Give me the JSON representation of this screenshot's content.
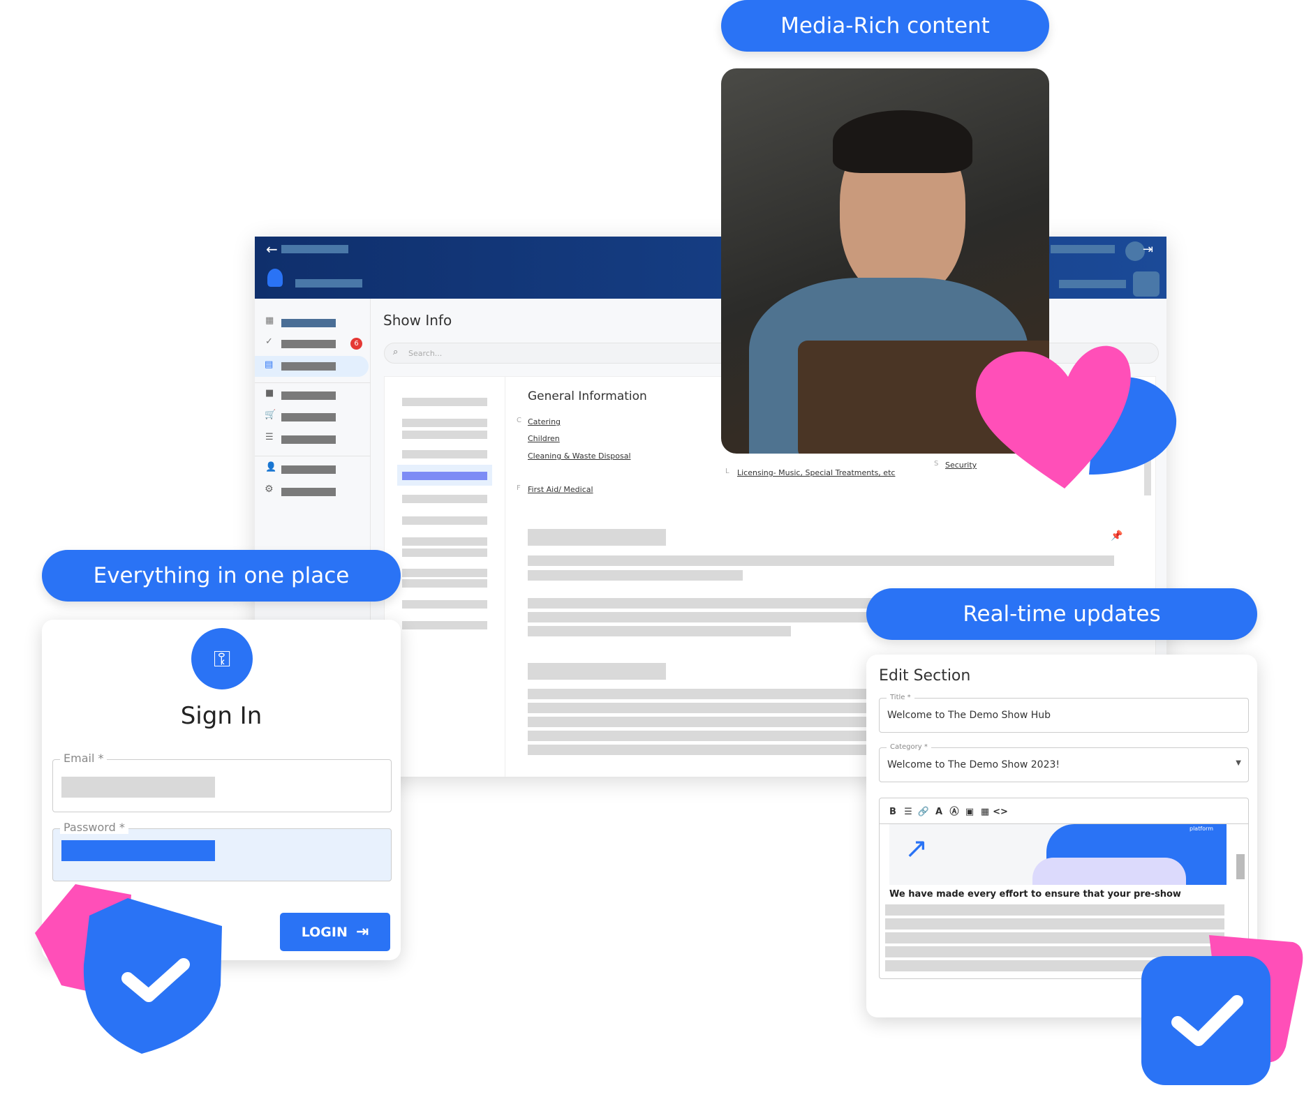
{
  "callouts": {
    "media": "Media-Rich content",
    "everything": "Everything in one place",
    "realtime": "Real-time updates"
  },
  "dashboard": {
    "page_title": "Show Info",
    "search_placeholder": "Search...",
    "sidebar_badge": "6",
    "section_title": "General Information",
    "groups": [
      {
        "letter": "C",
        "links": [
          "Catering",
          "Children",
          "Cleaning & Waste Disposal"
        ]
      },
      {
        "letter": "F",
        "links": [
          "First Aid/ Medical"
        ]
      },
      {
        "letter": "L",
        "links": [
          "Licensing- Music, Special Treatments, etc"
        ]
      },
      {
        "letter": "S",
        "links": [
          "Security"
        ]
      }
    ]
  },
  "signin": {
    "title": "Sign In",
    "email_label": "Email *",
    "password_label": "Password *",
    "login_label": "LOGIN"
  },
  "edit": {
    "title": "Edit Section",
    "title_label": "Title *",
    "title_value": "Welcome to The Demo Show Hub",
    "category_label": "Category *",
    "category_value": "Welcome to The Demo Show 2023!",
    "preview_text": "platform",
    "body_text": "We have made every effort to ensure that your pre-show"
  },
  "colors": {
    "accent": "#2a73f5",
    "pink": "#ff4fb8",
    "header": "#123a7e"
  }
}
